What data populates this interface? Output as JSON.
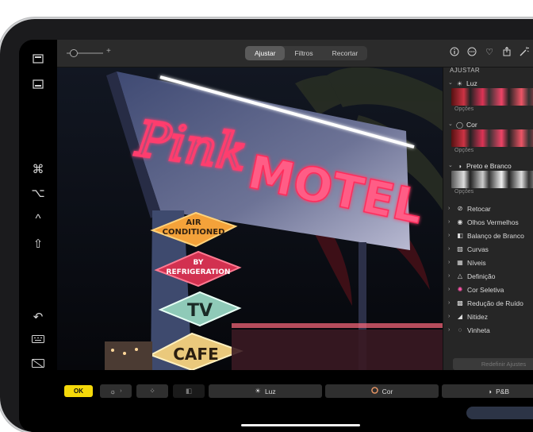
{
  "sidebar_strip": {
    "icons": [
      "dock-top-icon",
      "dock-bottom-icon",
      "command-icon",
      "option-icon",
      "control-icon",
      "shift-icon",
      "undo-icon",
      "keyboard-icon",
      "hide-keyboard-icon"
    ]
  },
  "toolbar": {
    "tabs": [
      {
        "label": "Ajustar",
        "active": true
      },
      {
        "label": "Filtros",
        "active": false
      },
      {
        "label": "Recortar",
        "active": false
      }
    ],
    "zoom_plus": "+",
    "right_icons": [
      "info-icon",
      "more-icon",
      "favorite-heart-icon",
      "share-icon",
      "magic-wand-icon"
    ]
  },
  "panel": {
    "title": "AJUSTAR",
    "sections": [
      {
        "label": "Luz",
        "icon": "sun-icon",
        "options_label": "Opções"
      },
      {
        "label": "Cor",
        "icon": "color-circle-icon",
        "options_label": "Opções"
      },
      {
        "label": "Preto e Branco",
        "icon": "half-circle-icon",
        "options_label": "Opções"
      }
    ],
    "items": [
      {
        "label": "Retocar",
        "icon": "bandage-icon"
      },
      {
        "label": "Olhos Vermelhos",
        "icon": "eye-icon"
      },
      {
        "label": "Balanço de Branco",
        "icon": "white-balance-icon"
      },
      {
        "label": "Curvas",
        "icon": "curves-icon"
      },
      {
        "label": "Níveis",
        "icon": "levels-icon"
      },
      {
        "label": "Definição",
        "icon": "definition-icon"
      },
      {
        "label": "Cor Seletiva",
        "icon": "selective-color-icon"
      },
      {
        "label": "Redução de Ruído",
        "icon": "noise-icon"
      },
      {
        "label": "Nitidez",
        "icon": "sharpness-icon"
      },
      {
        "label": "Vinheta",
        "icon": "vignette-icon"
      }
    ],
    "reset_label": "Redefinir Ajustes"
  },
  "photo": {
    "sign_script": "Pink",
    "sign_main": "MOTEL",
    "diamonds": [
      "AIR\nCONDITIONED",
      "BY\nREFRIGERATION",
      "TV",
      "CAFE"
    ]
  },
  "bottom": {
    "ok_label": "OK",
    "buttons": [
      {
        "label": "Luz",
        "icon": "sun-icon"
      },
      {
        "label": "Cor",
        "icon": "color-circle-icon"
      },
      {
        "label": "P&B",
        "icon": "half-circle-icon"
      }
    ]
  },
  "colors": {
    "accent_yellow": "#f5d90a",
    "neon_pink": "#ff3d6e",
    "panel_bg": "#262626"
  }
}
